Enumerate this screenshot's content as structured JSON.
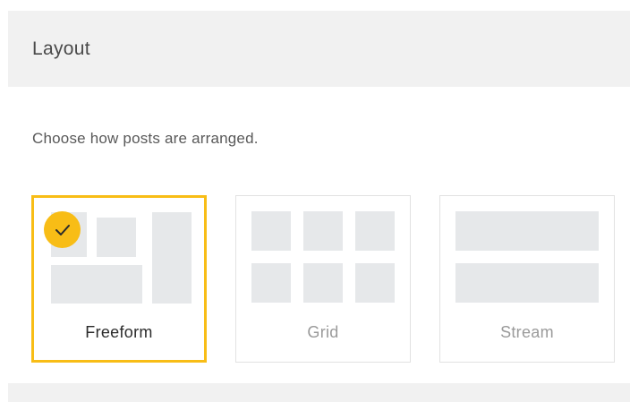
{
  "header": {
    "title": "Layout"
  },
  "description": "Choose how posts are arranged.",
  "layout_options": [
    {
      "id": "freeform",
      "label": "Freeform",
      "selected": true
    },
    {
      "id": "grid",
      "label": "Grid",
      "selected": false
    },
    {
      "id": "stream",
      "label": "Stream",
      "selected": false
    }
  ],
  "selected_icon": "checkmark-icon",
  "colors": {
    "accent": "#f8bd16",
    "header_bg": "#f1f1f1",
    "placeholder_block": "#e6e8ea",
    "card_border": "#e2e2e2"
  }
}
